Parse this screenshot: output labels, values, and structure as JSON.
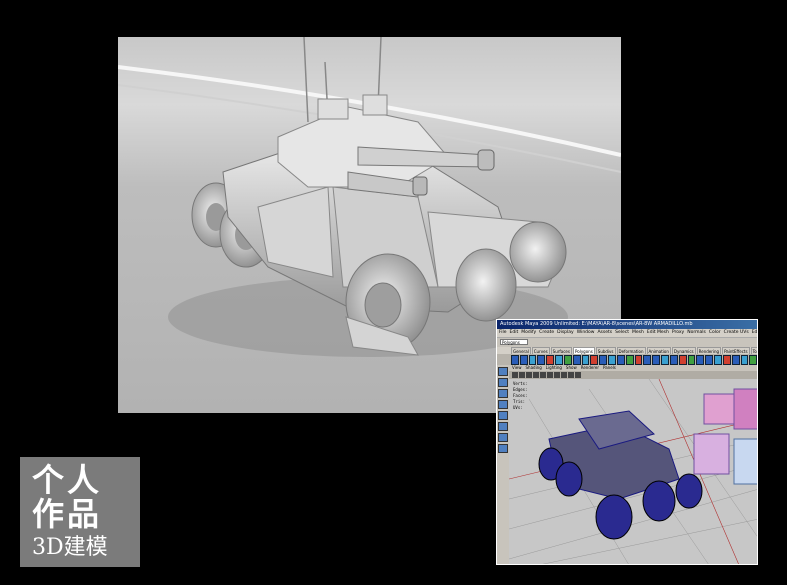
{
  "label": {
    "line1": "个人",
    "line2": "作品",
    "line3": "3D建模"
  },
  "maya": {
    "title": "Autodesk Maya 2009 Unlimited: E:\\MAYA\\AR-8\\scenes\\AR-8W ARMADILLO.mb",
    "menus": [
      "File",
      "Edit",
      "Modify",
      "Create",
      "Display",
      "Window",
      "Assets",
      "Select",
      "Mesh",
      "Edit Mesh",
      "Proxy",
      "Normals",
      "Color",
      "Create UVs",
      "Edit UVs",
      "Muscle",
      "Help"
    ],
    "mode": "Polygons",
    "shelf_tabs": [
      "General",
      "Curves",
      "Surfaces",
      "Polygons",
      "Subdivs",
      "Deformation",
      "Animation",
      "Dynamics",
      "Rendering",
      "PaintEffects",
      "Toon",
      "Muscle",
      "Fluids",
      "Fur",
      "Hair"
    ],
    "active_shelf_tab": "Polygons",
    "panel_menus": [
      "View",
      "Shading",
      "Lighting",
      "Show",
      "Renderer",
      "Panels"
    ],
    "hud": [
      "Verts:",
      "Edges:",
      "Faces:",
      "Tris:",
      "UVs:"
    ]
  },
  "colors": {
    "background": "#000000",
    "label_box": "#7b7b7b",
    "maya_chrome": "#d4d0c8",
    "maya_title": "#0a246a",
    "wire": "#1a1a80"
  }
}
